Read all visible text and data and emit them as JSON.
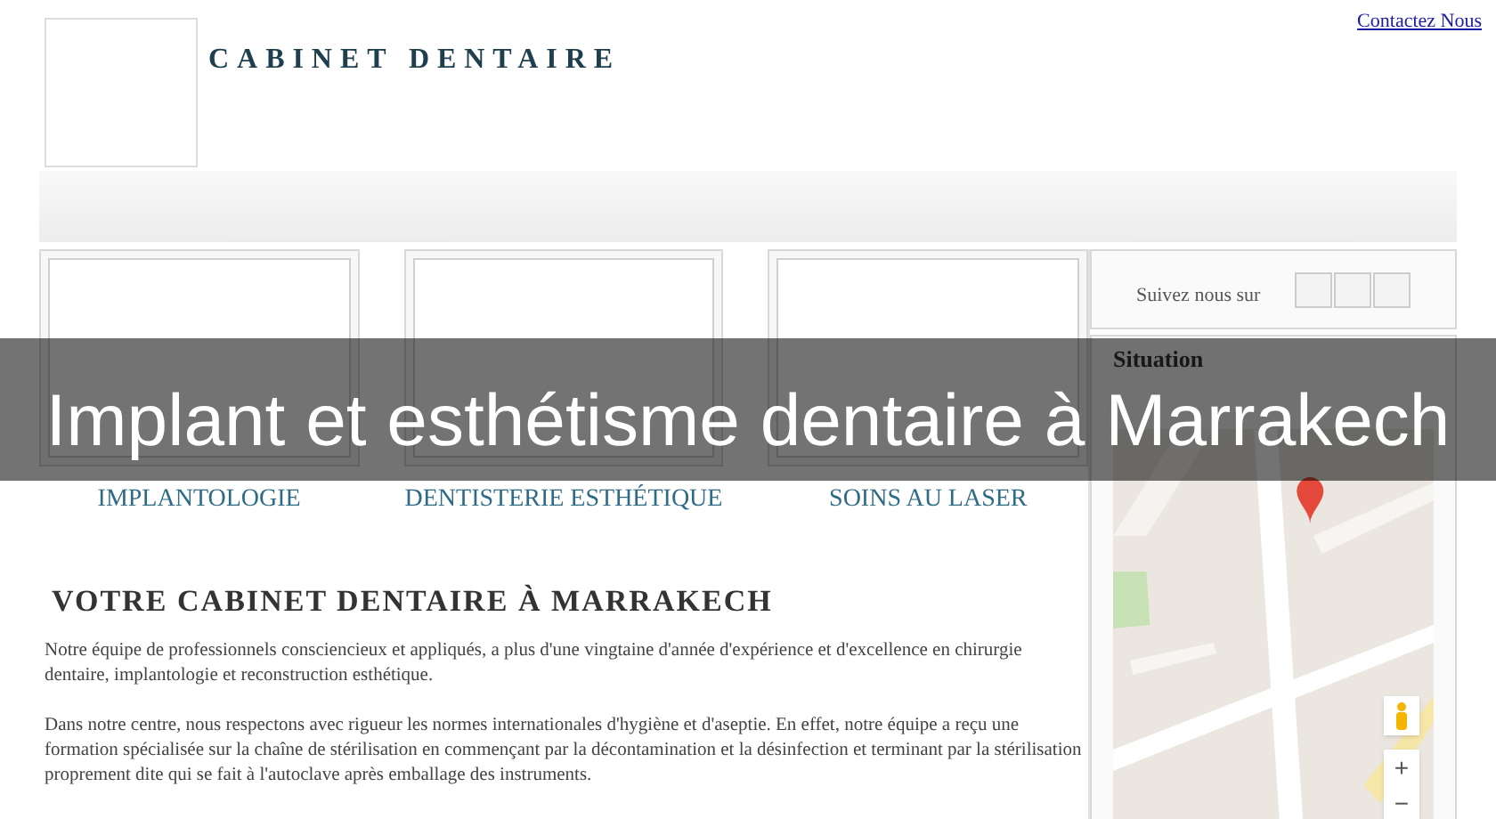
{
  "header": {
    "title": "CABINET DENTAIRE",
    "contact_link": "Contactez Nous"
  },
  "services": [
    {
      "label": "IMPLANTOLOGIE"
    },
    {
      "label": "DENTISTERIE ESTHÉTIQUE"
    },
    {
      "label": "SOINS AU LASER"
    }
  ],
  "main": {
    "heading": "VOTRE CABINET DENTAIRE À MARRAKECH",
    "paragraphs": [
      "Notre équipe de professionnels consciencieux et appliqués, a plus d'une vingtaine d'année d'expérience et d'excellence en chirurgie dentaire, implantologie et reconstruction esthétique.",
      "Dans notre centre, nous respectons avec rigueur les normes internationales d'hygiène et d'aseptie. En effet, notre équipe a reçu une formation spécialisée sur la chaîne de stérilisation en commençant par la décontamination et la désinfection et terminant par la stérilisation proprement dite qui se fait à l'autoclave après emballage des instruments."
    ]
  },
  "sidebar": {
    "follow_label": "Suivez nous sur",
    "social_icons": [
      {
        "kind": "box"
      },
      {
        "kind": "box"
      },
      {
        "kind": "box"
      }
    ],
    "location_title": "Situation",
    "map": {
      "kind": "picture",
      "zoom_in": "+",
      "zoom_out": "−"
    }
  },
  "banner": {
    "text": "Implant et esthétisme dentaire à Marrakech"
  }
}
